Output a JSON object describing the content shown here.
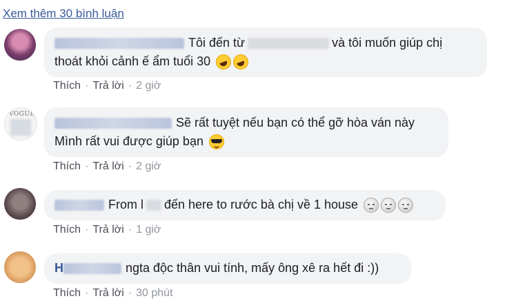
{
  "more_comments": "Xem thêm 30 bình luận",
  "comments": [
    {
      "text_before": "Tôi đến từ",
      "text_after": "và tôi muốn giúp chị",
      "line2": "thoát khỏi cảnh ế ẩm tuổi 30",
      "emoji": "rolling-on-floor-laughing-icon",
      "actions": {
        "like": "Thích",
        "reply": "Trả lời",
        "time": "2 giờ"
      }
    },
    {
      "text": "Sẽ rất tuyệt nếu bạn có thể gỡ hòa ván này",
      "line2": "Mình rất vui được giúp bạn",
      "emoji": "sunglasses-face-icon",
      "actions": {
        "like": "Thích",
        "reply": "Trả lời",
        "time": "2 giờ"
      }
    },
    {
      "text_before": "From l",
      "text_after": "đến here to rước bà chị về 1 house",
      "emoji": "moon-face-icon",
      "actions": {
        "like": "Thích",
        "reply": "Trả lời",
        "time": "1 giờ"
      }
    },
    {
      "name_initial": "H",
      "text": "ngta độc thân vui tính, mấy ông xê ra hết đi :))",
      "actions": {
        "like": "Thích",
        "reply": "Trả lời",
        "time": "30 phút"
      }
    }
  ],
  "avatar_text": {
    "vogue": "VOGUE"
  },
  "colors": {
    "link": "#385898",
    "bubble": "#f2f3f5",
    "meta": "#90949c"
  }
}
